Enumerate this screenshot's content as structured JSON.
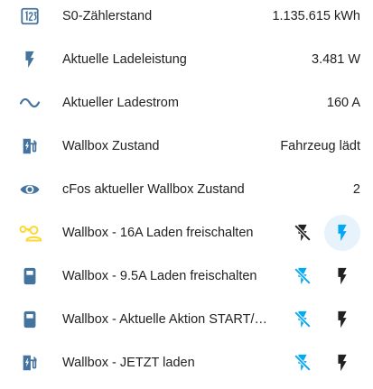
{
  "colors": {
    "icon_primary": "#44739e",
    "icon_active": "#fdd835",
    "accent_blue": "#03a9f4",
    "button_active_bg": "#e8f2fb",
    "text": "#212121",
    "dark_icon": "#212121"
  },
  "rows": [
    {
      "icon": "counter-icon",
      "label": "S0-Zählerstand",
      "value": "1.135.615 kWh"
    },
    {
      "icon": "flash-icon",
      "label": "Aktuelle Ladeleistung",
      "value": "3.481 W"
    },
    {
      "icon": "current-ac-icon",
      "label": "Aktueller Ladestrom",
      "value": "160 A"
    },
    {
      "icon": "ev-station-icon",
      "label": "Wallbox Zustand",
      "value": "Fahrzeug lädt"
    },
    {
      "icon": "eye-icon",
      "label": "cFos aktueller Wallbox Zustand",
      "value": "2"
    },
    {
      "icon": "account-key-icon",
      "label": "Wallbox - 16A Laden freischalten",
      "state": "on"
    },
    {
      "icon": "ev-plug-icon",
      "label": "Wallbox - 9.5A Laden freischalten",
      "state": "off"
    },
    {
      "icon": "ev-plug-icon",
      "label": "Wallbox - Aktuelle Aktion START/STOP",
      "state": "off"
    },
    {
      "icon": "ev-station-icon",
      "label": "Wallbox - JETZT laden",
      "state": "off"
    }
  ]
}
